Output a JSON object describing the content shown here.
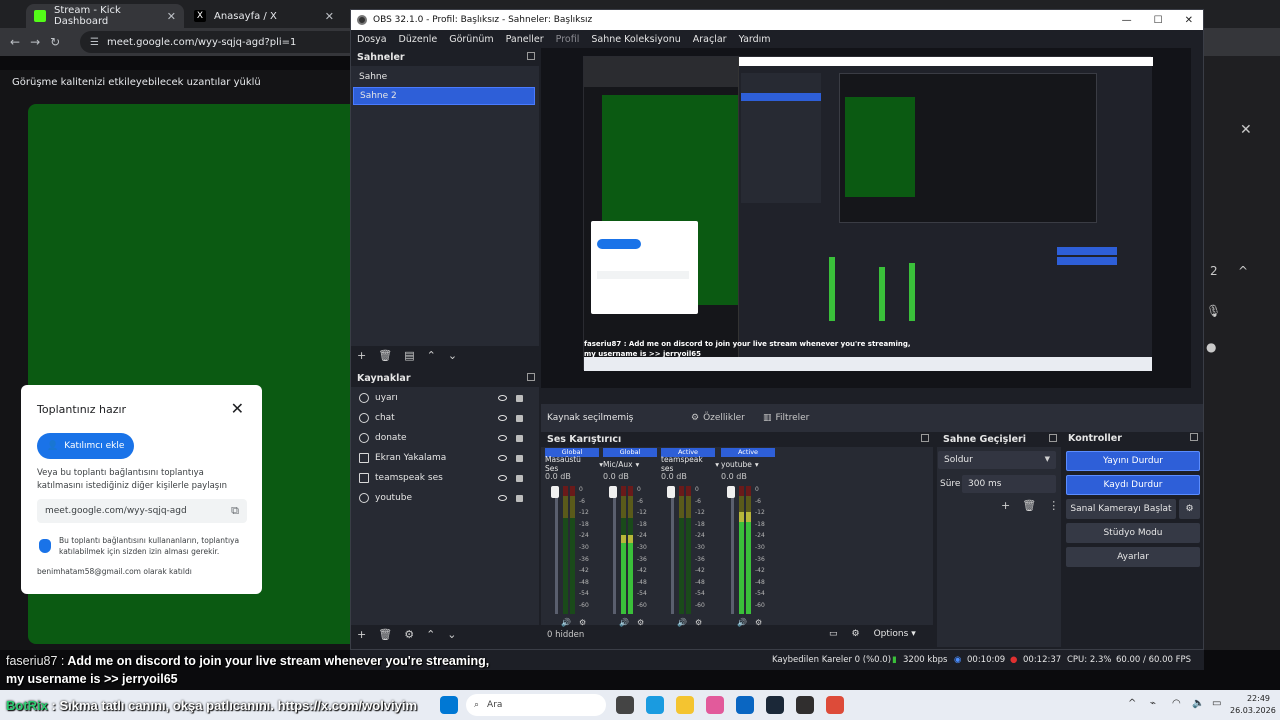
{
  "browser": {
    "tabs": [
      {
        "label": "Stream - Kick Dashboard"
      },
      {
        "label": "Anasayfa / X"
      }
    ],
    "url": "meet.google.com/wyy-sqjq-agd?pli=1"
  },
  "meet": {
    "banner": "Görüşme kalitenizi etkileyebilecek uzantılar yüklü",
    "card": {
      "title": "Toplantınız hazır",
      "add_button": "Katılımcı ekle",
      "description": "Veya bu toplantı bağlantısını toplantıya katılmasını istediğiniz diğer kişilerle paylaşın",
      "link": "meet.google.com/wyy-sqjq-agd",
      "note": "Bu toplantı bağlantısını kullananların, toplantıya katılabilmek için sizden izin alması gerekir.",
      "joined": "benimhatam58@gmail.com olarak katıldı"
    }
  },
  "obs": {
    "title": "OBS 32.1.0 - Profil: Başlıksız - Sahneler: Başlıksız",
    "menu": [
      "Dosya",
      "Düzenle",
      "Görünüm",
      "Paneller",
      "Profil",
      "Sahne Koleksiyonu",
      "Araçlar",
      "Yardım"
    ],
    "scenes_header": "Sahneler",
    "scenes": [
      "Sahne",
      "Sahne 2"
    ],
    "sources_header": "Kaynaklar",
    "sources": [
      {
        "name": "uyarı",
        "icon": "globe-icon"
      },
      {
        "name": "chat",
        "icon": "globe-icon"
      },
      {
        "name": "donate",
        "icon": "globe-icon"
      },
      {
        "name": "Ekran Yakalama",
        "icon": "monitor-icon"
      },
      {
        "name": "teamspeak ses",
        "icon": "audio-icon"
      },
      {
        "name": "youtube",
        "icon": "globe-icon"
      }
    ],
    "context": {
      "no_source": "Kaynak seçilmemiş",
      "properties": "Özellikler",
      "filters": "Filtreler"
    },
    "mixer": {
      "header": "Ses Karıştırıcı",
      "channels": [
        {
          "tag": "Global",
          "name": "Masaüstü Ses",
          "db": "0.0 dB",
          "level": 0
        },
        {
          "tag": "Global",
          "name": "Mic/Aux",
          "db": "0.0 dB",
          "level": 0.62
        },
        {
          "tag": "Active",
          "name": "teamspeak ses",
          "db": "0.0 dB",
          "level": 0
        },
        {
          "tag": "Active",
          "name": "youtube",
          "db": "0.0 dB",
          "level": 0.8
        }
      ],
      "scale": [
        "0",
        "-6",
        "-12",
        "-18",
        "-24",
        "-30",
        "-36",
        "-42",
        "-48",
        "-54",
        "-60"
      ],
      "hidden": "0 hidden",
      "options": "Options"
    },
    "transitions": {
      "header": "Sahne Geçişleri",
      "type": "Soldur",
      "duration_label": "Süre",
      "duration": "300 ms"
    },
    "controls": {
      "header": "Kontroller",
      "stop_stream": "Yayını Durdur",
      "stop_record": "Kaydı Durdur",
      "virtual_cam": "Sanal Kamerayı Başlat",
      "studio": "Stüdyo Modu",
      "settings": "Ayarlar"
    },
    "preview": {
      "caption1": "faseriu87 : Add me on discord to join your live stream whenever you're streaming,",
      "caption2": "my username is >> jerryoil65"
    },
    "status": {
      "dropped": "Kaybedilen Kareler 0 (%0.0)",
      "bitrate": "3200 kbps",
      "stream_time": "00:10:09",
      "rec_time": "00:12:37",
      "cpu": "CPU: 2.3%",
      "fps": "60.00 / 60.00 FPS"
    }
  },
  "chat": {
    "user": "faseriu87 :",
    "line1": "Add me on discord to join your live stream whenever you're streaming,",
    "line2": "my username is >> jerryoil65",
    "bot_user": "BotRix",
    "bot_msg": ": Sıkma tatlı canını, okşa patlıcanını. https://x.com/wolviyim"
  },
  "taskbar": {
    "search": "Ara",
    "time": "22:49",
    "date": "26.03.2026"
  }
}
